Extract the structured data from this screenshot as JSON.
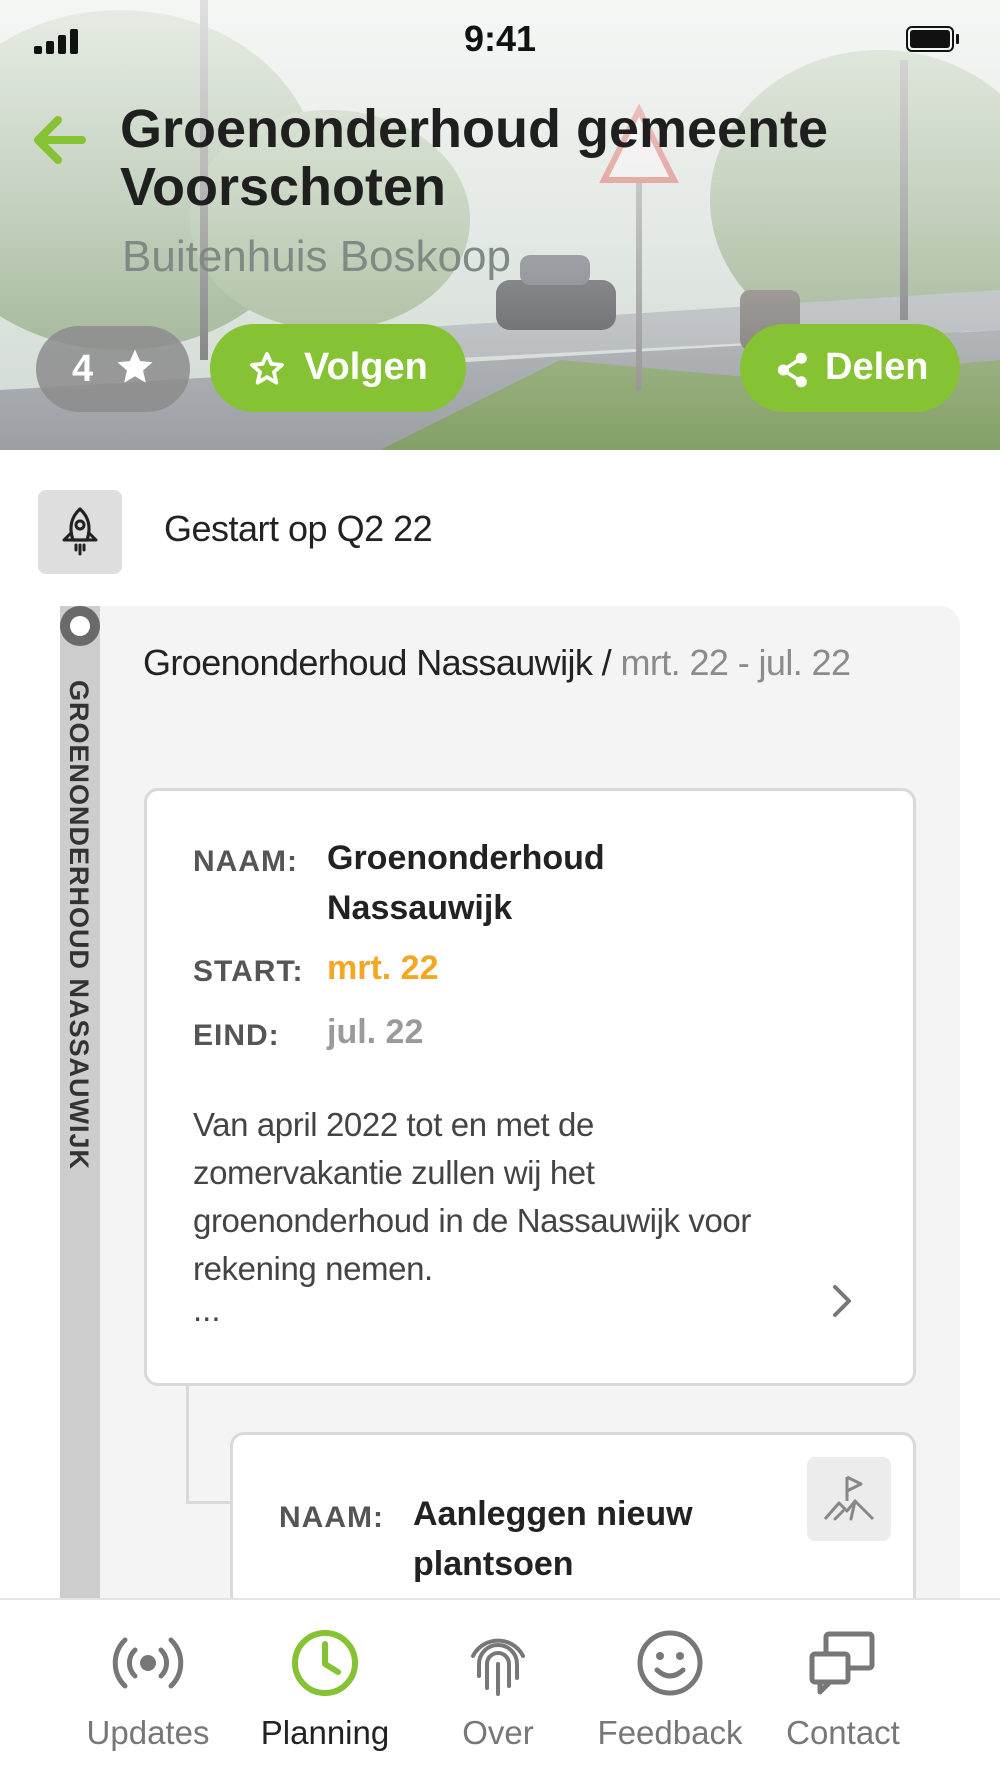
{
  "status_bar": {
    "time": "9:41"
  },
  "header": {
    "title": "Groenonderhoud gemeente Voorschoten",
    "subtitle": "Buitenhuis Boskoop",
    "rating": "4",
    "follow_label": "Volgen",
    "share_label": "Delen",
    "accent_color": "#85c234"
  },
  "started": {
    "text": "Gestart op Q2 22"
  },
  "phase": {
    "timeline_label": "GROENONDERHOUD NASSAUWIJK",
    "title_name": "Groenonderhoud Nassauwijk / ",
    "title_dates": "mrt. 22 - jul. 22"
  },
  "card1": {
    "name_label": "NAAM:",
    "name_value": "Groenonderhoud Nassauwijk",
    "start_label": "START:",
    "start_value": "mrt. 22",
    "start_color": "#f5a623",
    "end_label": "EIND:",
    "end_value": "jul. 22",
    "description": "Van april 2022 tot en met de zomervakantie zullen wij het groenonderhoud in de Nassauwijk voor rekening nemen.",
    "ellipsis": "..."
  },
  "card2": {
    "name_label": "NAAM:",
    "name_value": "Aanleggen nieuw plantsoen",
    "icon": "milestone-flag-icon"
  },
  "tabs": [
    {
      "label": "Updates",
      "icon": "broadcast-icon",
      "active": false
    },
    {
      "label": "Planning",
      "icon": "clock-icon",
      "active": true
    },
    {
      "label": "Over",
      "icon": "fingerprint-icon",
      "active": false
    },
    {
      "label": "Feedback",
      "icon": "smiley-icon",
      "active": false
    },
    {
      "label": "Contact",
      "icon": "chat-icon",
      "active": false
    }
  ]
}
